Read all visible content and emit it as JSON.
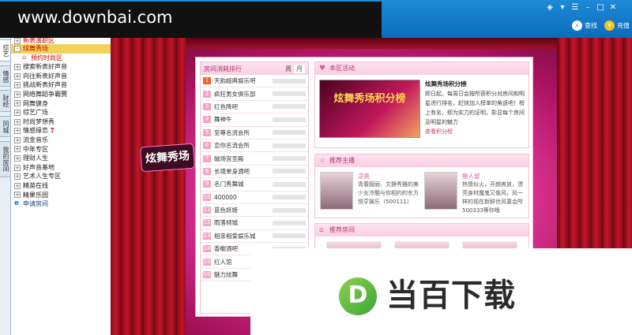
{
  "watermark": "www.downbai.com",
  "toolbar": {
    "search_label": "查找",
    "recharge_label": "充值"
  },
  "window_icons": [
    "skin-icon",
    "tshirt-icon",
    "menu-icon",
    "minimize-icon",
    "maximize-icon",
    "close-icon"
  ],
  "vertical_tabs": [
    {
      "label": "综艺",
      "active": true
    },
    {
      "label": "情感",
      "active": false
    },
    {
      "label": "财经",
      "active": false
    },
    {
      "label": "同城",
      "active": false
    },
    {
      "label": "我的房间",
      "active": false
    }
  ],
  "sidebar": {
    "items": [
      {
        "label": "新表演职区",
        "type": "cut"
      },
      {
        "label": "炫舞秀场",
        "type": "selected",
        "toggle": "-"
      },
      {
        "label": "预约时尚区",
        "type": "sub"
      },
      {
        "label": "搜索新表好声音",
        "toggle": "+"
      },
      {
        "label": "向往新表好声音",
        "toggle": "+"
      },
      {
        "label": "挑战新表好声音",
        "toggle": "+"
      },
      {
        "label": "网络舞蹈争霸赛",
        "toggle": "+"
      },
      {
        "label": "网舞健身",
        "toggle": "+"
      },
      {
        "label": "综艺广场",
        "toggle": "+"
      },
      {
        "label": "时尚梦想秀",
        "toggle": "+"
      },
      {
        "label": "情感缘恋",
        "toggle": "+",
        "deco": "❣"
      },
      {
        "label": "流金音乐",
        "toggle": "+"
      },
      {
        "label": "中年专区",
        "toggle": "+"
      },
      {
        "label": "理财人生",
        "toggle": "+"
      },
      {
        "label": "好声音基地",
        "toggle": "+"
      },
      {
        "label": "艺术人生专区",
        "toggle": "+"
      },
      {
        "label": "精英在线",
        "toggle": "+"
      },
      {
        "label": "精果乐园",
        "toggle": "+"
      },
      {
        "label": "申请房间",
        "type": "link"
      }
    ]
  },
  "stage": {
    "badge": "炫舞秀场"
  },
  "rank": {
    "title": "房间消耗排行",
    "tabs": [
      "周",
      "月"
    ],
    "rows": [
      {
        "n": "1",
        "name": "天韵超典娱乐吧",
        "hot": true
      },
      {
        "n": "2",
        "name": "疯狂男女俱乐部",
        "hot": false
      },
      {
        "n": "3",
        "name": "红色降吧",
        "hot": false
      },
      {
        "n": "4",
        "name": "舞神牛",
        "hot": false
      },
      {
        "n": "5",
        "name": "至尊名流会所",
        "hot": false
      },
      {
        "n": "6",
        "name": "恋你名流会所",
        "hot": false
      },
      {
        "n": "7",
        "name": "磁场宫圣殿",
        "hot": false
      },
      {
        "n": "8",
        "name": "长境单身酒吧",
        "hot": false
      },
      {
        "n": "9",
        "name": "名门秀舞城",
        "hot": false
      },
      {
        "n": "10",
        "name": "400000",
        "hot": false
      },
      {
        "n": "11",
        "name": "蓝色妖姬",
        "hot": false
      },
      {
        "n": "12",
        "name": "雨落倾城",
        "hot": false
      },
      {
        "n": "13",
        "name": "相亲相爱娱乐城",
        "hot": false
      },
      {
        "n": "14",
        "name": "香榭酒吧",
        "hot": false
      },
      {
        "n": "15",
        "name": "红人馆",
        "hot": false
      },
      {
        "n": "16",
        "name": "魅力炫舞",
        "hot": false
      }
    ]
  },
  "activity": {
    "title": "本区活动",
    "banner": "炫舞秀场积分榜",
    "headline": "炫舞秀场积分榜",
    "body": "即日起，每周日会按所获积分对房间和明星进行排名，赶快加入榜单的角逐吧！榜上有名，即为实力的证明，彰显每个房间及明星的魅力",
    "link": "查看积分榜"
  },
  "anchors": {
    "title": "推荐主播",
    "items": [
      {
        "name": "凉爽",
        "desc": "青春靓丽、文静秀雅的美少女冷酷与你相约的东方悦亨娱乐（500111）"
      },
      {
        "name": "鲍人留",
        "desc": "热情似火，开朗爽放，漂亮身材魔鬼又像风，风一样的视在新鲜世风童会所500333等你哦"
      }
    ]
  },
  "rooms": {
    "title": "推荐房间"
  },
  "ad": {
    "logo": "D",
    "text": "当百下载"
  }
}
